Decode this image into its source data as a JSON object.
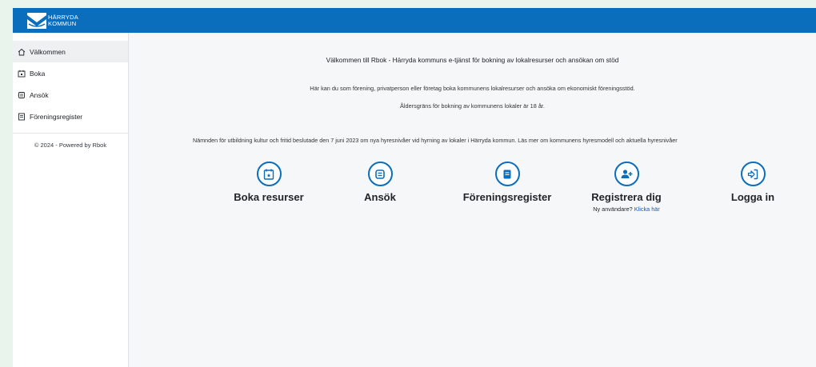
{
  "header": {
    "logo_line1": "HÄRRYDA",
    "logo_line2": "KOMMUN",
    "brand_color": "#0a6ebd"
  },
  "sidebar": {
    "items": [
      {
        "label": "Välkommen",
        "icon": "home-icon",
        "active": true
      },
      {
        "label": "Boka",
        "icon": "calendar-icon",
        "active": false
      },
      {
        "label": "Ansök",
        "icon": "apply-icon",
        "active": false
      },
      {
        "label": "Föreningsregister",
        "icon": "book-icon",
        "active": false
      }
    ],
    "footer": "© 2024 - Powered by Rbok"
  },
  "main": {
    "title": "Välkommen till Rbok - Härryda kommuns e-tjänst för bokning av lokalresurser och ansökan om stöd",
    "intro1": "Här kan du som förening, privatperson eller företag boka kommunens lokalresurser och ansöka om ekonomiskt föreningsstöd.",
    "intro2": "Åldersgräns för bokning av kommunens lokaler är 18 år.",
    "notice": "Nämnden för utbildning kultur och fritid beslutade den 7 juni 2023 om nya hyresnivåer vid hyrning av lokaler i Härryda kommun. Läs mer om kommunens hyresmodell och aktuella hyresnivåer",
    "cards": [
      {
        "label": "Boka resurser",
        "icon": "calendar-star-icon"
      },
      {
        "label": "Ansök",
        "icon": "apply-icon"
      },
      {
        "label": "Föreningsregister",
        "icon": "book-icon"
      },
      {
        "label": "Registrera dig",
        "icon": "user-plus-icon",
        "sub_text": "Ny användare?",
        "sub_link": "Klicka här"
      },
      {
        "label": "Logga in",
        "icon": "login-icon"
      }
    ]
  }
}
